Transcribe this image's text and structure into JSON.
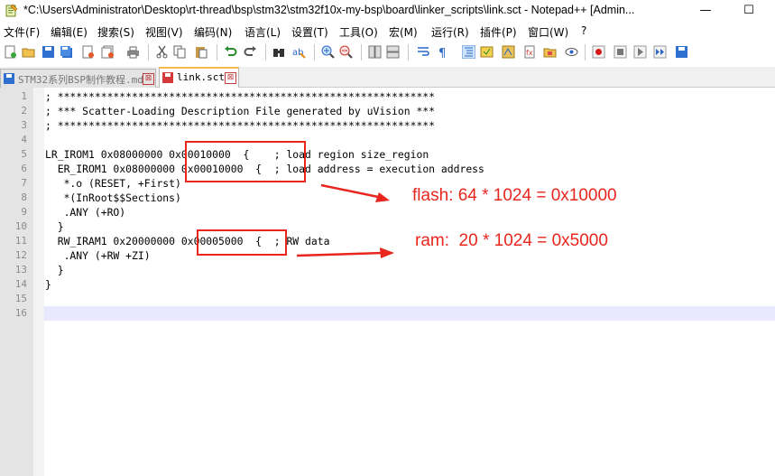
{
  "window": {
    "title": "*C:\\Users\\Administrator\\Desktop\\rt-thread\\bsp\\stm32\\stm32f10x-my-bsp\\board\\linker_scripts\\link.sct - Notepad++ [Admin...",
    "minimize_glyph": "—",
    "maximize_glyph": "☐"
  },
  "menu": [
    {
      "label": "文件(F)"
    },
    {
      "label": "编辑(E)"
    },
    {
      "label": "搜索(S)"
    },
    {
      "label": "视图(V)"
    },
    {
      "label": "编码(N)"
    },
    {
      "label": "语言(L)"
    },
    {
      "label": "设置(T)"
    },
    {
      "label": "工具(O)"
    },
    {
      "label": "宏(M)"
    },
    {
      "label": "运行(R)"
    },
    {
      "label": "插件(P)"
    },
    {
      "label": "窗口(W)"
    },
    {
      "label": "?"
    }
  ],
  "toolbar_icons": [
    "new-file-icon",
    "open-file-icon",
    "save-icon",
    "save-all-icon",
    "close-icon",
    "close-all-icon",
    "print-icon",
    "cut-icon",
    "copy-icon",
    "paste-icon",
    "undo-icon",
    "redo-icon",
    "find-icon",
    "replace-icon",
    "zoom-in-icon",
    "zoom-out-icon",
    "sync-vertical-icon",
    "sync-horizontal-icon",
    "wrap-icon",
    "show-all-chars-icon",
    "indent-guide-icon",
    "udl-icon",
    "doc-map-icon",
    "function-list-icon",
    "folder-as-workspace-icon",
    "monitor-icon",
    "record-macro-icon",
    "stop-macro-icon",
    "play-macro-icon",
    "run-macro-multiple-icon",
    "save-macro-icon"
  ],
  "tabs": [
    {
      "label": "STM32系列BSP制作教程.md",
      "active": false,
      "close": "⊠"
    },
    {
      "label": "link.sct",
      "active": true,
      "close": "⊠"
    }
  ],
  "editor": {
    "lines": [
      {
        "num": "1",
        "text": "; *************************************************************"
      },
      {
        "num": "2",
        "text": "; *** Scatter-Loading Description File generated by uVision ***"
      },
      {
        "num": "3",
        "text": "; *************************************************************"
      },
      {
        "num": "4",
        "text": ""
      },
      {
        "num": "5",
        "text": "LR_IROM1 0x08000000 0x00010000  {    ; load region size_region"
      },
      {
        "num": "6",
        "text": "  ER_IROM1 0x08000000 0x00010000  {  ; load address = execution address"
      },
      {
        "num": "7",
        "text": "   *.o (RESET, +First)"
      },
      {
        "num": "8",
        "text": "   *(InRoot$$Sections)"
      },
      {
        "num": "9",
        "text": "   .ANY (+RO)"
      },
      {
        "num": "10",
        "text": "  }"
      },
      {
        "num": "11",
        "text": "  RW_IRAM1 0x20000000 0x00005000  {  ; RW data"
      },
      {
        "num": "12",
        "text": "   .ANY (+RW +ZI)"
      },
      {
        "num": "13",
        "text": "  }"
      },
      {
        "num": "14",
        "text": "}"
      },
      {
        "num": "15",
        "text": ""
      },
      {
        "num": "16",
        "text": ""
      }
    ],
    "current_line": "16"
  },
  "annotations": {
    "flash": "flash: 64 * 1024 = 0x10000",
    "ram": "ram:  20 * 1024 = 0x5000",
    "color": "#e8261e"
  }
}
